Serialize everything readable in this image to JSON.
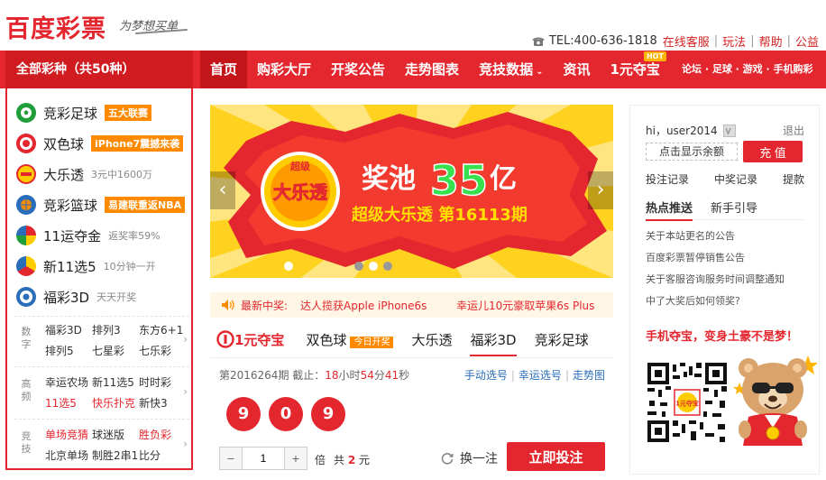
{
  "header": {
    "logo": "百度彩票",
    "slogan": "为梦想买单",
    "tel": "TEL:400-636-1818",
    "links": [
      "在线客服",
      "玩法",
      "帮助",
      "公益"
    ]
  },
  "nav": {
    "all_categories": "全部彩种（共50种）",
    "items": [
      {
        "label": "首页"
      },
      {
        "label": "购彩大厅"
      },
      {
        "label": "开奖公告"
      },
      {
        "label": "走势图表"
      },
      {
        "label": "竞技数据"
      },
      {
        "label": "资讯"
      },
      {
        "label": "1元夺宝",
        "badge": "HOT"
      }
    ],
    "right_links": "论坛 · 足球 · 游戏 · 手机购彩"
  },
  "sidebar": {
    "lotteries": [
      {
        "name": "竞彩足球",
        "tag": "五大联赛",
        "desc": ""
      },
      {
        "name": "双色球",
        "tag": "iPhone7震撼来袭",
        "desc": ""
      },
      {
        "name": "大乐透",
        "tag": "",
        "desc": "3元中1600万"
      },
      {
        "name": "竞彩篮球",
        "tag": "易建联重返NBA",
        "desc": ""
      },
      {
        "name": "11运夺金",
        "tag": "",
        "desc": "返奖率59%"
      },
      {
        "name": "新11选5",
        "tag": "",
        "desc": "10分钟一开"
      },
      {
        "name": "福彩3D",
        "tag": "",
        "desc": "天天开奖"
      }
    ],
    "groups": [
      {
        "label": "数字",
        "items": [
          "福彩3D",
          "排列3",
          "东方6+1",
          "排列5",
          "七星彩",
          "七乐彩"
        ]
      },
      {
        "label": "高频",
        "items": [
          "幸运农场",
          "新11选5",
          "时时彩",
          "11选5",
          "快乐扑克",
          "新快3"
        ]
      },
      {
        "label": "竞技",
        "items": [
          "单场竞猜",
          "球迷版",
          "胜负彩",
          "北京单场",
          "制胜2串1",
          "比分"
        ]
      }
    ]
  },
  "banner": {
    "badge_top": "超级",
    "badge_main": "大乐透",
    "headline_pre": "奖池",
    "headline_num": "35",
    "headline_post": "亿",
    "subline": "超级大乐透 第16113期"
  },
  "news": {
    "label": "最新中奖:",
    "items": [
      "达人揽获Apple iPhone6s",
      "幸运儿10元豪取苹果6s Plus"
    ]
  },
  "tabs": {
    "brand": "1元夺宝",
    "items": [
      {
        "label": "双色球",
        "badge": "今日开奖"
      },
      {
        "label": "大乐透",
        "badge": ""
      },
      {
        "label": "福彩3D",
        "badge": ""
      },
      {
        "label": "竞彩足球",
        "badge": ""
      }
    ]
  },
  "issue": {
    "prefix": "第2016264期 截止：",
    "hours": "18",
    "h_unit": "小时",
    "minutes": "54",
    "m_unit": "分",
    "seconds": "41",
    "s_unit": "秒",
    "links": [
      "手动选号",
      "幸运选号",
      "走势图"
    ]
  },
  "balls": [
    "9",
    "0",
    "9"
  ],
  "bet": {
    "minus": "−",
    "plus": "+",
    "multiplier": "1",
    "mult_label": "倍",
    "total_pre": "共",
    "total_amount": "2",
    "total_unit": "元",
    "change_label": "换一注",
    "buy_label": "立即投注"
  },
  "user": {
    "greeting": "hi，user2014",
    "logout": "退出",
    "balance_label": "点击显示余额",
    "recharge_label": "充 值",
    "links": [
      "投注记录",
      "中奖记录",
      "提款"
    ]
  },
  "right_tabs": [
    "热点推送",
    "新手引导"
  ],
  "notices": [
    "关于本站更名的公告",
    "百度彩票暂停销售公告",
    "关于客服咨询服务时间调整通知",
    "中了大奖后如何领奖?"
  ],
  "mobile": {
    "title": "手机夺宝，变身土豪不是梦！",
    "qr_text": "1元夺宝"
  },
  "colors": {
    "primary": "#e4262e",
    "accent": "#ff8a00",
    "banner": "#ffd21f"
  }
}
